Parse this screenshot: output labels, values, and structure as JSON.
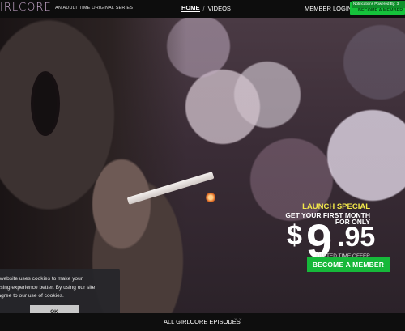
{
  "header": {
    "logo_text": "IRLCORE",
    "tagline": "AN ADULT TIME ORIGINAL SERIES",
    "nav": {
      "home": "HOME",
      "separator": "/",
      "videos": "VIDEOS"
    },
    "member_login": "MEMBER LOGIN",
    "become_member_short": "BECOME A MEMBER",
    "notification_text": "Notifications Powered By: 3"
  },
  "promo": {
    "launch_special": "LAUNCH SPECIAL",
    "get_your_first_month": "GET YOUR FIRST MONTH",
    "for_only": "FOR ONLY",
    "price_dollar": "$",
    "price_major": "9",
    "price_minor": ".95",
    "limited_time_offer": "LIMITED TIME OFFER",
    "cta_label": "BECOME A MEMBER"
  },
  "cookie_banner": {
    "lines": [
      "ur website uses cookies to make your",
      "owsing experience better. By using our site",
      "u agree to our use of cookies."
    ],
    "ok_label": "OK"
  },
  "footer": {
    "episodes_label": "ALL GIRLCORE EPISODES",
    "chevron": "⌄⌄"
  },
  "colors": {
    "accent_green": "#16b83a",
    "launch_yellow": "#f2e84a",
    "logo_pink": "#d9b7de"
  }
}
